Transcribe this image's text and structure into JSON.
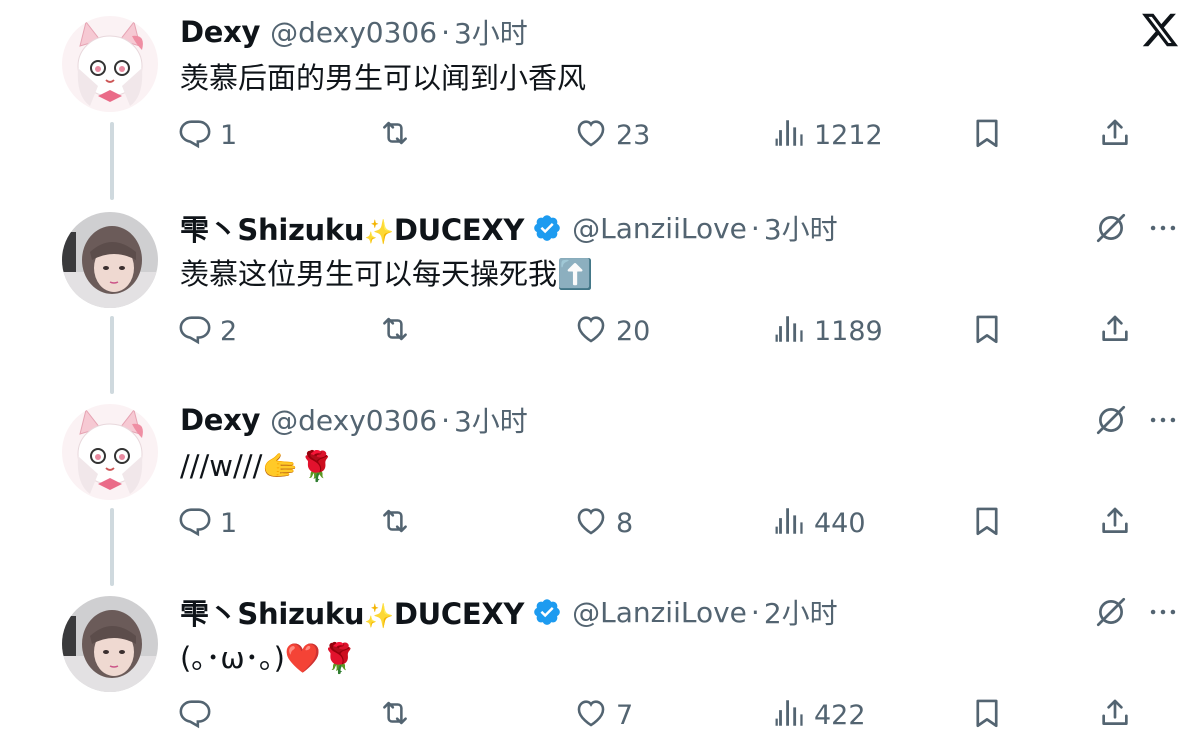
{
  "tweets": [
    {
      "name": "Dexy",
      "name_emoji": "",
      "name_suffix": "",
      "verified": false,
      "handle": "@dexy0306",
      "time": "3小时",
      "text": "羡慕后面的男生可以闻到小香风",
      "replies": "1",
      "retweets": "",
      "likes": "23",
      "views": "1212"
    },
    {
      "name": "雫丶Shizuku",
      "name_emoji": "✨",
      "name_suffix": "DUCEXY",
      "verified": true,
      "handle": "@LanziiLove",
      "time": "3小时",
      "text": "羡慕这位男生可以每天操死我⬆️",
      "replies": "2",
      "retweets": "",
      "likes": "20",
      "views": "1189"
    },
    {
      "name": "Dexy",
      "name_emoji": "",
      "name_suffix": "",
      "verified": false,
      "handle": "@dexy0306",
      "time": "3小时",
      "text": "///w///🫱🌹",
      "replies": "1",
      "retweets": "",
      "likes": "8",
      "views": "440"
    },
    {
      "name": "雫丶Shizuku",
      "name_emoji": "✨",
      "name_suffix": "DUCEXY",
      "verified": true,
      "handle": "@LanziiLove",
      "time": "2小时",
      "text": "(｡･ω･｡)❤️🌹",
      "replies": "",
      "retweets": "",
      "likes": "7",
      "views": "422"
    }
  ],
  "separator": "·",
  "colors": {
    "text": "#0f1419",
    "secondary": "#536471",
    "thread_line": "#cfd9de",
    "verified": "#1d9bf0"
  },
  "icons": [
    "x-logo-icon",
    "reply-icon",
    "retweet-icon",
    "like-icon",
    "views-icon",
    "bookmark-icon",
    "share-icon",
    "grok-icon",
    "more-icon",
    "verified-badge-icon"
  ]
}
